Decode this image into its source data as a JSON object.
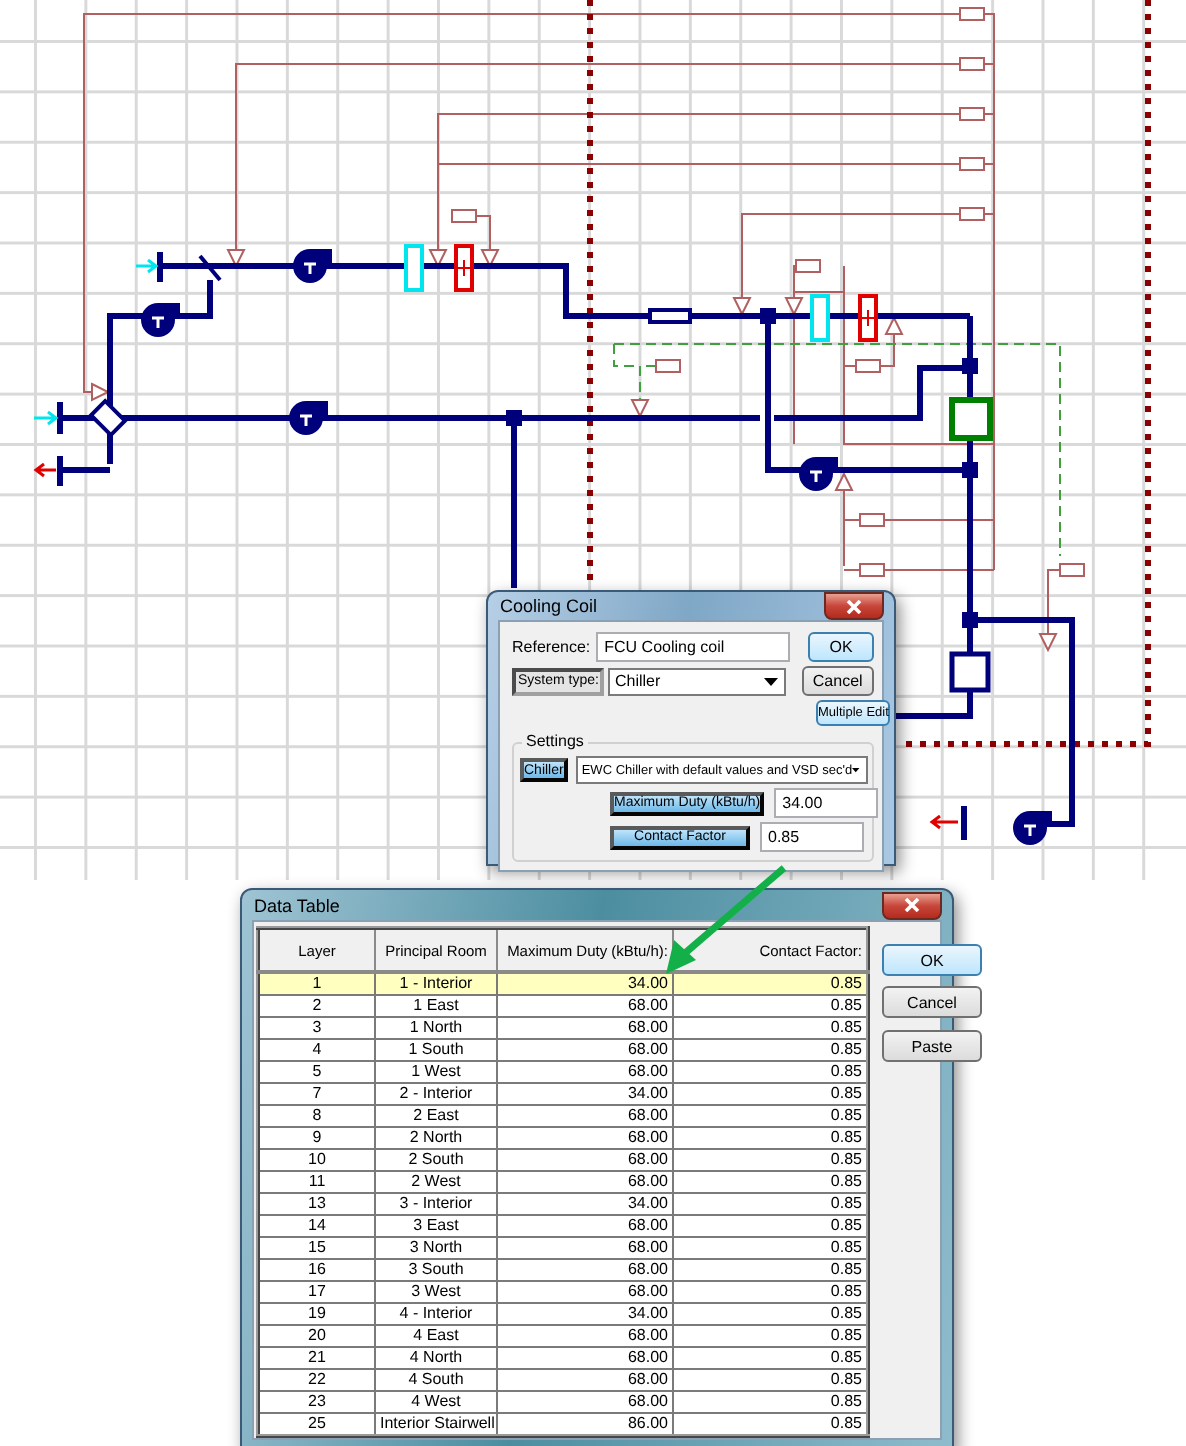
{
  "cooling_coil_dialog": {
    "title": "Cooling Coil",
    "reference_label": "Reference:",
    "reference_value": "FCU Cooling coil",
    "system_type_label": "System type:",
    "system_type_value": "Chiller",
    "settings_label": "Settings",
    "chiller_button": "Chiller",
    "chiller_value": "EWC Chiller with default values and VSD sec'd",
    "max_duty_button": "Maximum Duty (kBtu/h)",
    "max_duty_value": "34.00",
    "contact_factor_button": "Contact Factor",
    "contact_factor_value": "0.85",
    "buttons": [
      "OK",
      "Cancel",
      "Multiple Edit"
    ]
  },
  "data_table_dialog": {
    "title": "Data Table",
    "columns": [
      "Layer",
      "Principal Room",
      "Maximum Duty (kBtu/h):",
      "Contact Factor:"
    ],
    "rows": [
      {
        "cells": [
          "1",
          "1 - Interior",
          "34.00",
          "0.85"
        ],
        "selected": true
      },
      {
        "cells": [
          "2",
          "1 East",
          "68.00",
          "0.85"
        ],
        "selected": false
      },
      {
        "cells": [
          "3",
          "1 North",
          "68.00",
          "0.85"
        ],
        "selected": false
      },
      {
        "cells": [
          "4",
          "1 South",
          "68.00",
          "0.85"
        ],
        "selected": false
      },
      {
        "cells": [
          "5",
          "1 West",
          "68.00",
          "0.85"
        ],
        "selected": false
      },
      {
        "cells": [
          "7",
          "2 - Interior",
          "34.00",
          "0.85"
        ],
        "selected": false
      },
      {
        "cells": [
          "8",
          "2 East",
          "68.00",
          "0.85"
        ],
        "selected": false
      },
      {
        "cells": [
          "9",
          "2 North",
          "68.00",
          "0.85"
        ],
        "selected": false
      },
      {
        "cells": [
          "10",
          "2 South",
          "68.00",
          "0.85"
        ],
        "selected": false
      },
      {
        "cells": [
          "11",
          "2 West",
          "68.00",
          "0.85"
        ],
        "selected": false
      },
      {
        "cells": [
          "13",
          "3 - Interior",
          "34.00",
          "0.85"
        ],
        "selected": false
      },
      {
        "cells": [
          "14",
          "3 East",
          "68.00",
          "0.85"
        ],
        "selected": false
      },
      {
        "cells": [
          "15",
          "3 North",
          "68.00",
          "0.85"
        ],
        "selected": false
      },
      {
        "cells": [
          "16",
          "3 South",
          "68.00",
          "0.85"
        ],
        "selected": false
      },
      {
        "cells": [
          "17",
          "3 West",
          "68.00",
          "0.85"
        ],
        "selected": false
      },
      {
        "cells": [
          "19",
          "4 - Interior",
          "34.00",
          "0.85"
        ],
        "selected": false
      },
      {
        "cells": [
          "20",
          "4 East",
          "68.00",
          "0.85"
        ],
        "selected": false
      },
      {
        "cells": [
          "21",
          "4 North",
          "68.00",
          "0.85"
        ],
        "selected": false
      },
      {
        "cells": [
          "22",
          "4 South",
          "68.00",
          "0.85"
        ],
        "selected": false
      },
      {
        "cells": [
          "23",
          "4 West",
          "68.00",
          "0.85"
        ],
        "selected": false
      },
      {
        "cells": [
          "25",
          "Interior Stairwell",
          "86.00",
          "0.85"
        ],
        "selected": false
      }
    ],
    "buttons": [
      "OK",
      "Cancel",
      "Paste"
    ]
  }
}
